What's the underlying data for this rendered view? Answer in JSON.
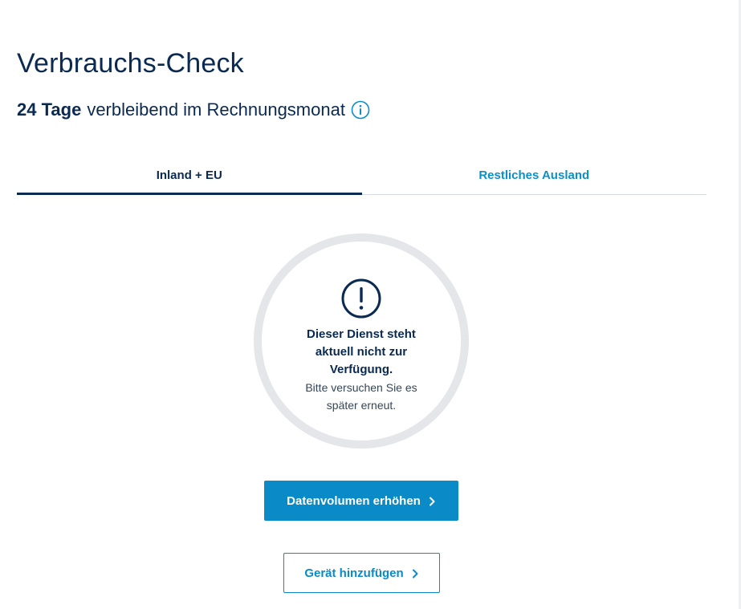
{
  "page": {
    "title": "Verbrauchs-Check",
    "days_bold": "24 Tage",
    "days_text": "verbleibend im Rechnungsmonat"
  },
  "tabs": [
    {
      "label": "Inland + EU",
      "active": true
    },
    {
      "label": "Restliches Ausland",
      "active": false
    }
  ],
  "status": {
    "title": "Dieser Dienst steht aktuell nicht zur Verfügung.",
    "subtitle": "Bitte versuchen Sie es später erneut."
  },
  "actions": {
    "primary_label": "Datenvolumen erhöhen",
    "secondary_label": "Gerät hinzufügen"
  },
  "icons": {
    "info": "info-icon",
    "warning": "exclamation-circle-icon",
    "chevron": "chevron-right-icon"
  },
  "colors": {
    "navy": "#0a2a52",
    "accent": "#0a8bc7",
    "gauge_track": "#e4e6e9"
  }
}
